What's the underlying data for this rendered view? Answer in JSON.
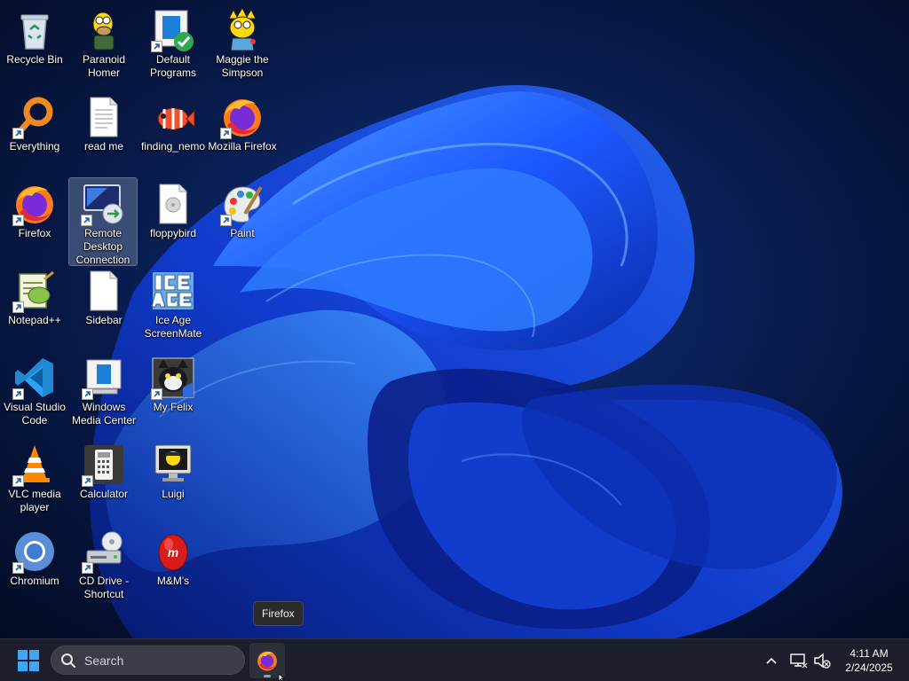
{
  "desktop": {
    "icons": [
      {
        "label": "Recycle Bin"
      },
      {
        "label": "Paranoid Homer"
      },
      {
        "label": "Default Programs"
      },
      {
        "label": "Maggie the Simpson"
      },
      {
        "label": "Everything"
      },
      {
        "label": "read me"
      },
      {
        "label": "finding_nemo"
      },
      {
        "label": "Mozilla Firefox"
      },
      {
        "label": "Firefox"
      },
      {
        "label": "Remote Desktop Connection"
      },
      {
        "label": "floppybird"
      },
      {
        "label": "Paint"
      },
      {
        "label": "Notepad++"
      },
      {
        "label": "Sidebar"
      },
      {
        "label": "Ice Age ScreenMate"
      },
      {
        "label": "Visual Studio Code"
      },
      {
        "label": "Windows Media Center"
      },
      {
        "label": "My Felix"
      },
      {
        "label": "VLC media player"
      },
      {
        "label": "Calculator"
      },
      {
        "label": "Luigi"
      },
      {
        "label": "Chromium"
      },
      {
        "label": "CD Drive - Shortcut"
      },
      {
        "label": "M&M's"
      }
    ]
  },
  "tooltip": {
    "text": "Firefox"
  },
  "taskbar": {
    "search_label": "Search",
    "pinned": [
      {
        "name": "Firefox",
        "icon": "firefox-icon"
      }
    ],
    "clock": {
      "time": "4:11 AM",
      "date": "2/24/2025"
    }
  },
  "colors": {
    "wallpaper_bg": "#050d24",
    "bloom_blue": "#1f5cff",
    "taskbar_bg": "#1c1f2b",
    "start_blue": "#3fa6f5"
  }
}
